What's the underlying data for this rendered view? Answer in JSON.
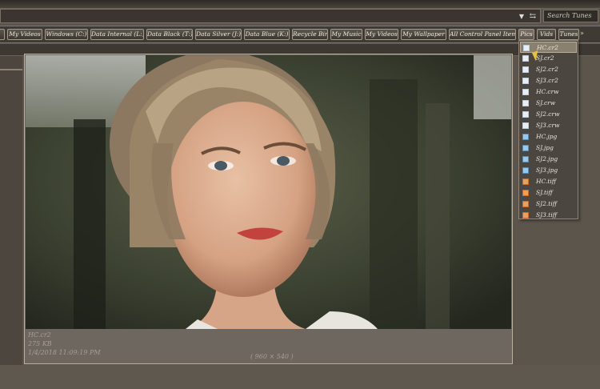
{
  "search": {
    "placeholder": "Search Tunes"
  },
  "toolbar": {
    "tabs": [
      {
        "label": "My Videos"
      },
      {
        "label": "Windows (C:)"
      },
      {
        "label": "Data Internal (L:)"
      },
      {
        "label": "Data Black (T:)"
      },
      {
        "label": "Data Silver (J:)"
      },
      {
        "label": "Data Blue (K:)"
      },
      {
        "label": "Recycle Bin"
      },
      {
        "label": "My Music"
      },
      {
        "label": "My Videos"
      },
      {
        "label": "My Wallpaper"
      },
      {
        "label": "All Control Panel Items"
      },
      {
        "label": "Pics"
      },
      {
        "label": "Vids"
      },
      {
        "label": "Tunes"
      }
    ],
    "overflow": "»"
  },
  "preview": {
    "filename": "HC.cr2",
    "size": "275 KB",
    "date": "1/4/2018 11:09:19 PM",
    "dimensions": "( 960 × 540 )",
    "photo_icon": "portrait-photo"
  },
  "menu": {
    "items": [
      {
        "label": "HC.cr2",
        "icon": "cr2-icon"
      },
      {
        "label": "SJ.cr2",
        "icon": "cr2-icon"
      },
      {
        "label": "SJ2.cr2",
        "icon": "cr2-icon"
      },
      {
        "label": "SJ3.cr2",
        "icon": "cr2-icon"
      },
      {
        "label": "HC.crw",
        "icon": "crw-icon"
      },
      {
        "label": "SJ.crw",
        "icon": "crw-icon"
      },
      {
        "label": "SJ2.crw",
        "icon": "crw-icon"
      },
      {
        "label": "SJ3.crw",
        "icon": "crw-icon"
      },
      {
        "label": "HC.jpg",
        "icon": "jpg-icon"
      },
      {
        "label": "SJ.jpg",
        "icon": "jpg-icon"
      },
      {
        "label": "SJ2.jpg",
        "icon": "jpg-icon"
      },
      {
        "label": "SJ3.jpg",
        "icon": "jpg-icon"
      },
      {
        "label": "HC.tiff",
        "icon": "tiff-icon"
      },
      {
        "label": "SJ.tiff",
        "icon": "tiff-icon"
      },
      {
        "label": "SJ2.tiff",
        "icon": "tiff-icon"
      },
      {
        "label": "SJ3.tiff",
        "icon": "tiff-icon"
      }
    ]
  },
  "colors": {
    "frame": "#5a544c",
    "toolbar": "#403a34",
    "highlight": "#8a8070"
  }
}
